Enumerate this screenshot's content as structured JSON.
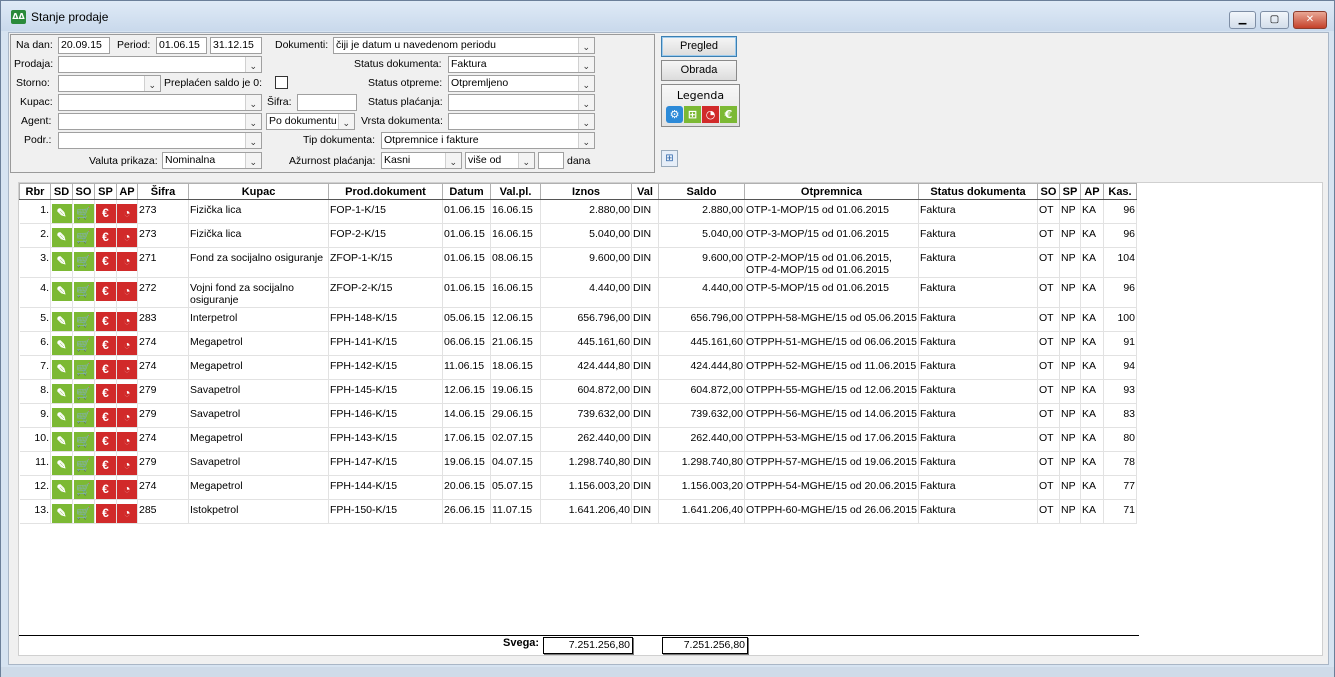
{
  "window": {
    "title": "Stanje prodaje",
    "min": "▭",
    "max": "▢",
    "close": "✕"
  },
  "filters": {
    "na_dan_label": "Na dan:",
    "na_dan": "20.09.15",
    "period_label": "Period:",
    "period_from": "01.06.15",
    "period_to": "31.12.15",
    "prodaja_label": "Prodaja:",
    "storno_label": "Storno:",
    "preplacen_label": "Preplaćen saldo je 0:",
    "kupac_label": "Kupac:",
    "sifra_label": "Šifra:",
    "agent_label": "Agent:",
    "agent_mode": "Po dokumentu",
    "podr_label": "Podr.:",
    "valuta_label": "Valuta prikaza:",
    "valuta": "Nominalna",
    "dokumenti_label": "Dokumenti:",
    "dokumenti": "čiji je datum u navedenom periodu",
    "status_dok_label": "Status dokumenta:",
    "status_dok": "Faktura",
    "status_otp_label": "Status otpreme:",
    "status_otp": "Otpremljeno",
    "status_pl_label": "Status plaćanja:",
    "vrsta_label": "Vrsta dokumenta:",
    "tip_label": "Tip dokumenta:",
    "tip": "Otpremnice i fakture",
    "azurnost_label": "Ažurnost plaćanja:",
    "azurnost": "Kasni",
    "vise": "više od",
    "dana": "dana"
  },
  "buttons": {
    "pregled": "Pregled",
    "obrada": "Obrada",
    "legenda": "Legenda"
  },
  "columns": [
    "Rbr",
    "SD",
    "SO",
    "SP",
    "AP",
    "Šifra",
    "Kupac",
    "Prod.dokument",
    "Datum",
    "Val.pl.",
    "Iznos",
    "Val",
    "Saldo",
    "Otpremnica",
    "Status dokumenta",
    "SO",
    "SP",
    "AP",
    "Kas."
  ],
  "rows": [
    {
      "rbr": "1.",
      "sifra": "273",
      "kupac": "Fizička lica",
      "dok": "FOP-1-K/15",
      "datum": "01.06.15",
      "valpl": "16.06.15",
      "iznos": "2.880,00",
      "val": "DIN",
      "saldo": "2.880,00",
      "otp": "OTP-1-MOP/15 od 01.06.2015",
      "status": "Faktura",
      "so": "OT",
      "sp": "NP",
      "ap": "KA",
      "kas": "96"
    },
    {
      "rbr": "2.",
      "sifra": "273",
      "kupac": "Fizička lica",
      "dok": "FOP-2-K/15",
      "datum": "01.06.15",
      "valpl": "16.06.15",
      "iznos": "5.040,00",
      "val": "DIN",
      "saldo": "5.040,00",
      "otp": "OTP-3-MOP/15 od 01.06.2015",
      "status": "Faktura",
      "so": "OT",
      "sp": "NP",
      "ap": "KA",
      "kas": "96"
    },
    {
      "rbr": "3.",
      "sifra": "271",
      "kupac": "Fond za socijalno osiguranje",
      "dok": "ZFOP-1-K/15",
      "datum": "01.06.15",
      "valpl": "08.06.15",
      "iznos": "9.600,00",
      "val": "DIN",
      "saldo": "9.600,00",
      "otp": "OTP-2-MOP/15 od 01.06.2015, OTP-4-MOP/15 od 01.06.2015",
      "status": "Faktura",
      "so": "OT",
      "sp": "NP",
      "ap": "KA",
      "kas": "104"
    },
    {
      "rbr": "4.",
      "sifra": "272",
      "kupac": "Vojni fond za socijalno osiguranje",
      "dok": "ZFOP-2-K/15",
      "datum": "01.06.15",
      "valpl": "16.06.15",
      "iznos": "4.440,00",
      "val": "DIN",
      "saldo": "4.440,00",
      "otp": "OTP-5-MOP/15 od 01.06.2015",
      "status": "Faktura",
      "so": "OT",
      "sp": "NP",
      "ap": "KA",
      "kas": "96"
    },
    {
      "rbr": "5.",
      "sifra": "283",
      "kupac": "Interpetrol",
      "dok": "FPH-148-K/15",
      "datum": "05.06.15",
      "valpl": "12.06.15",
      "iznos": "656.796,00",
      "val": "DIN",
      "saldo": "656.796,00",
      "otp": "OTPPH-58-MGHE/15 od 05.06.2015",
      "status": "Faktura",
      "so": "OT",
      "sp": "NP",
      "ap": "KA",
      "kas": "100"
    },
    {
      "rbr": "6.",
      "sifra": "274",
      "kupac": "Megapetrol",
      "dok": "FPH-141-K/15",
      "datum": "06.06.15",
      "valpl": "21.06.15",
      "iznos": "445.161,60",
      "val": "DIN",
      "saldo": "445.161,60",
      "otp": "OTPPH-51-MGHE/15 od 06.06.2015",
      "status": "Faktura",
      "so": "OT",
      "sp": "NP",
      "ap": "KA",
      "kas": "91"
    },
    {
      "rbr": "7.",
      "sifra": "274",
      "kupac": "Megapetrol",
      "dok": "FPH-142-K/15",
      "datum": "11.06.15",
      "valpl": "18.06.15",
      "iznos": "424.444,80",
      "val": "DIN",
      "saldo": "424.444,80",
      "otp": "OTPPH-52-MGHE/15 od 11.06.2015",
      "status": "Faktura",
      "so": "OT",
      "sp": "NP",
      "ap": "KA",
      "kas": "94"
    },
    {
      "rbr": "8.",
      "sifra": "279",
      "kupac": "Savapetrol",
      "dok": "FPH-145-K/15",
      "datum": "12.06.15",
      "valpl": "19.06.15",
      "iznos": "604.872,00",
      "val": "DIN",
      "saldo": "604.872,00",
      "otp": "OTPPH-55-MGHE/15 od 12.06.2015",
      "status": "Faktura",
      "so": "OT",
      "sp": "NP",
      "ap": "KA",
      "kas": "93"
    },
    {
      "rbr": "9.",
      "sifra": "279",
      "kupac": "Savapetrol",
      "dok": "FPH-146-K/15",
      "datum": "14.06.15",
      "valpl": "29.06.15",
      "iznos": "739.632,00",
      "val": "DIN",
      "saldo": "739.632,00",
      "otp": "OTPPH-56-MGHE/15 od 14.06.2015",
      "status": "Faktura",
      "so": "OT",
      "sp": "NP",
      "ap": "KA",
      "kas": "83"
    },
    {
      "rbr": "10.",
      "sifra": "274",
      "kupac": "Megapetrol",
      "dok": "FPH-143-K/15",
      "datum": "17.06.15",
      "valpl": "02.07.15",
      "iznos": "262.440,00",
      "val": "DIN",
      "saldo": "262.440,00",
      "otp": "OTPPH-53-MGHE/15 od 17.06.2015",
      "status": "Faktura",
      "so": "OT",
      "sp": "NP",
      "ap": "KA",
      "kas": "80"
    },
    {
      "rbr": "11.",
      "sifra": "279",
      "kupac": "Savapetrol",
      "dok": "FPH-147-K/15",
      "datum": "19.06.15",
      "valpl": "04.07.15",
      "iznos": "1.298.740,80",
      "val": "DIN",
      "saldo": "1.298.740,80",
      "otp": "OTPPH-57-MGHE/15 od 19.06.2015",
      "status": "Faktura",
      "so": "OT",
      "sp": "NP",
      "ap": "KA",
      "kas": "78"
    },
    {
      "rbr": "12.",
      "sifra": "274",
      "kupac": "Megapetrol",
      "dok": "FPH-144-K/15",
      "datum": "20.06.15",
      "valpl": "05.07.15",
      "iznos": "1.156.003,20",
      "val": "DIN",
      "saldo": "1.156.003,20",
      "otp": "OTPPH-54-MGHE/15 od 20.06.2015",
      "status": "Faktura",
      "so": "OT",
      "sp": "NP",
      "ap": "KA",
      "kas": "77"
    },
    {
      "rbr": "13.",
      "sifra": "285",
      "kupac": "Istokpetrol",
      "dok": "FPH-150-K/15",
      "datum": "26.06.15",
      "valpl": "11.07.15",
      "iznos": "1.641.206,40",
      "val": "DIN",
      "saldo": "1.641.206,40",
      "otp": "OTPPH-60-MGHE/15 od 26.06.2015",
      "status": "Faktura",
      "so": "OT",
      "sp": "NP",
      "ap": "KA",
      "kas": "71"
    }
  ],
  "totals": {
    "label": "Svega:",
    "iznos": "7.251.256,80",
    "saldo": "7.251.256,80"
  },
  "icons": {
    "sd": "✎",
    "so": "🛒",
    "sp": "€",
    "ap": "◔"
  },
  "colors": {
    "green": "#7cb934",
    "red": "#d12a2a",
    "blue": "#2c8ad8"
  }
}
